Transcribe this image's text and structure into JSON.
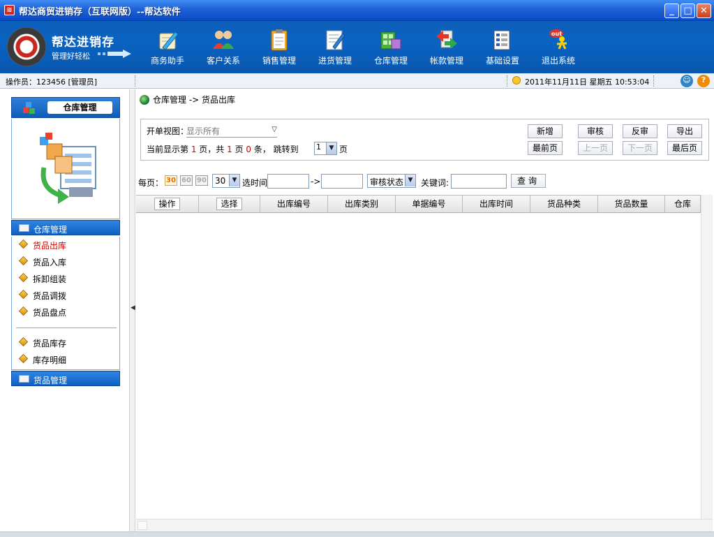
{
  "window": {
    "title": "帮达商贸进销存（互联网版）--帮达软件"
  },
  "brand": {
    "name": "帮达进销存",
    "slogan": "管理好轻松"
  },
  "nav": [
    {
      "label": "商务助手",
      "icon": "pen-icon"
    },
    {
      "label": "客户关系",
      "icon": "people-icon"
    },
    {
      "label": "销售管理",
      "icon": "clipboard-icon"
    },
    {
      "label": "进货管理",
      "icon": "edit-document-icon"
    },
    {
      "label": "仓库管理",
      "icon": "warehouse-icon"
    },
    {
      "label": "帐款管理",
      "icon": "exchange-icon"
    },
    {
      "label": "基础设置",
      "icon": "settings-document-icon"
    },
    {
      "label": "退出系统",
      "icon": "exit-icon"
    }
  ],
  "status": {
    "operator": "操作员：123456 [管理员]",
    "datetime": "2011年11月11日  星期五  10:53:04"
  },
  "sidebar": {
    "header": "仓库管理",
    "section1": "仓库管理",
    "items": [
      {
        "label": "货品出库",
        "active": true
      },
      {
        "label": "货品入库"
      },
      {
        "label": "拆卸组装"
      },
      {
        "label": "货品调拨"
      },
      {
        "label": "货品盘点"
      },
      {
        "label": "货品库存"
      },
      {
        "label": "库存明细"
      }
    ],
    "section2": "货品管理"
  },
  "breadcrumb": "仓库管理  ->  货品出库",
  "toolbar": {
    "view_label": "开单视图：",
    "view_value": "显示所有",
    "pager": {
      "p1": "当前显示第 ",
      "current": "1",
      "p2": " 页，共 ",
      "total_pages": "1",
      "p3": " 页 ",
      "total_items": "0",
      "p4": " 条，  跳转到",
      "jump_value": "1",
      "p5": "页"
    },
    "buttons": {
      "add": "新增",
      "audit": "审核",
      "unaudit": "反审",
      "export": "导出",
      "first": "最前页",
      "prev": "上一页",
      "next": "下一页",
      "last": "最后页"
    }
  },
  "filter": {
    "per_page_label": "每页：",
    "sizes": [
      "30",
      "60",
      "90"
    ],
    "size_select": "30",
    "time_label": "选时间",
    "arrow": "->",
    "audit_select": "审核状态",
    "keyword_label": "关键词:",
    "query_button": "查询"
  },
  "grid": {
    "columns": [
      "操作",
      "选择",
      "出库编号",
      "出库类别",
      "单据编号",
      "出库时间",
      "货品种类",
      "货品数量",
      "仓库"
    ]
  },
  "colors": {
    "banner": "#0a63c2",
    "titlebar": "#1f62d8",
    "accent_red": "#d40000",
    "pgsize_active": "#e07000"
  }
}
